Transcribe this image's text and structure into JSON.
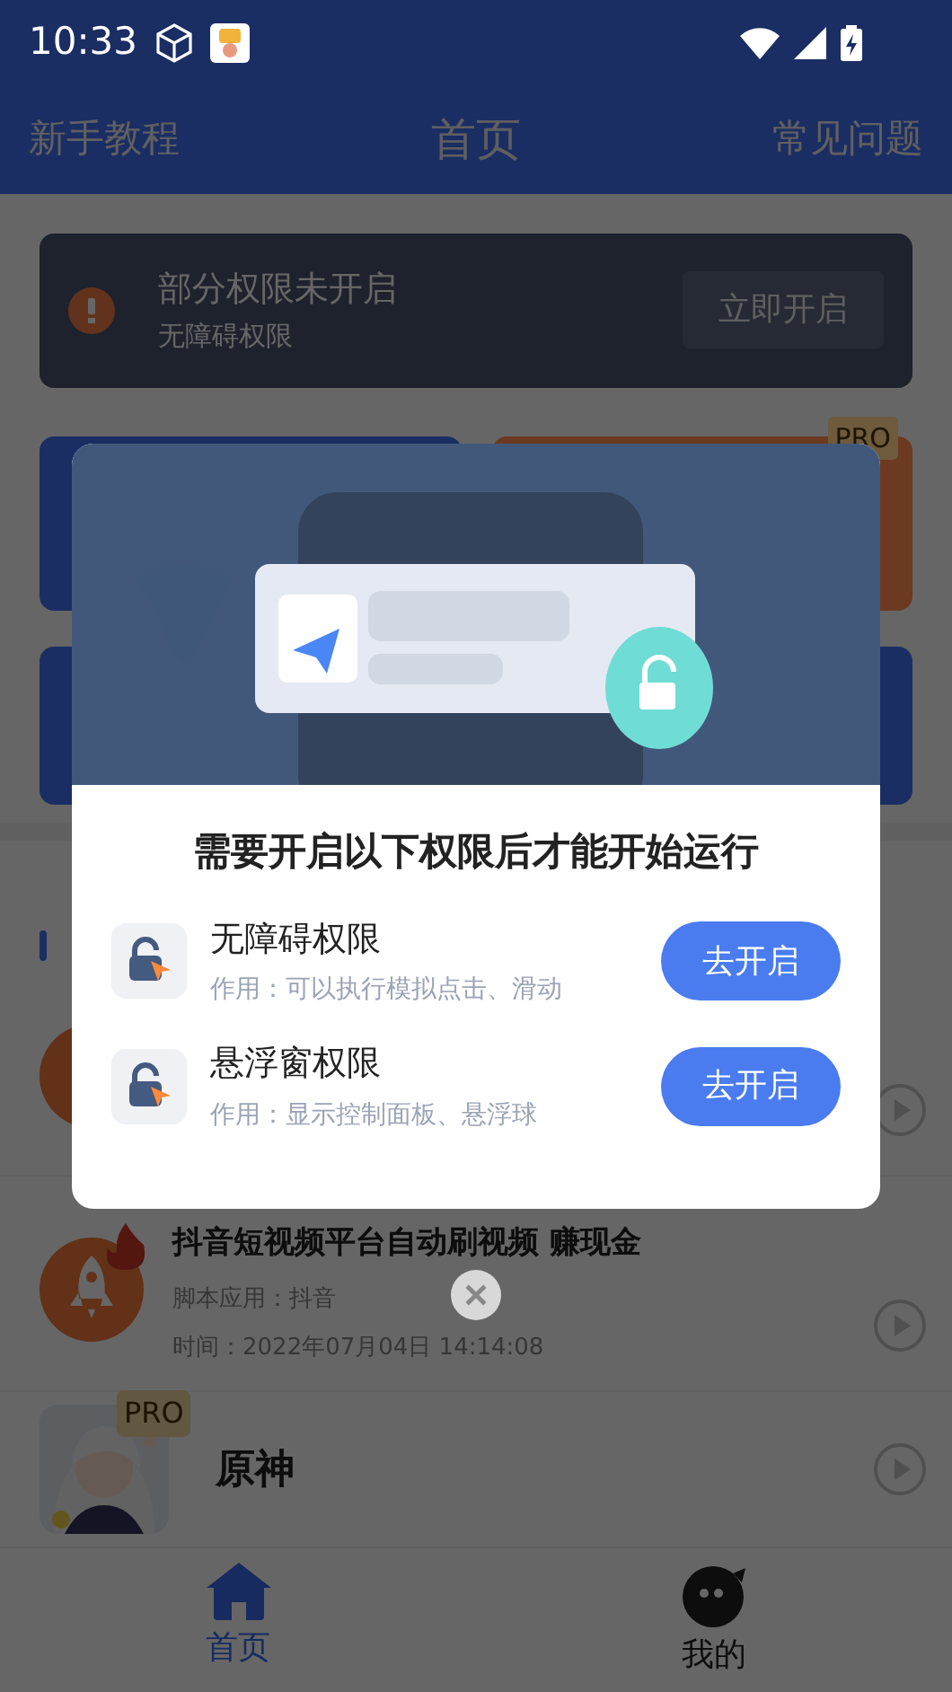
{
  "status_bar": {
    "time": "10:33"
  },
  "header": {
    "left_link": "新手教程",
    "title": "首页",
    "right_link": "常见问题"
  },
  "permission_banner": {
    "title": "部分权限未开启",
    "subtitle": "无障碍权限",
    "button": "立即开启"
  },
  "feature_cards": [
    {
      "color": "#1b2e63"
    },
    {
      "color": "#6b3a20",
      "badge": "PRO"
    },
    {
      "color": "#1b2e63"
    }
  ],
  "scripts": [
    {
      "kind": "circle"
    },
    {
      "kind": "rocket",
      "hot": true,
      "title": "抖音短视频平台自动刷视频 赚现金",
      "app": "脚本应用：抖音",
      "time": "时间：2022年07月04日 14:14:08"
    },
    {
      "kind": "picture",
      "badge": "PRO",
      "title": "原神"
    }
  ],
  "bottom_nav": [
    {
      "kind": "home",
      "label": "首页",
      "selected": true
    },
    {
      "kind": "face",
      "label": "我的",
      "selected": false
    }
  ],
  "dialog": {
    "title": "需要开启以下权限后才能开始运行",
    "permissions": [
      {
        "name": "无障碍权限",
        "description": "作用：可以执行模拟点击、滑动",
        "button": "去开启"
      },
      {
        "name": "悬浮窗权限",
        "description": "作用：显示控制面板、悬浮球",
        "button": "去开启"
      }
    ]
  }
}
